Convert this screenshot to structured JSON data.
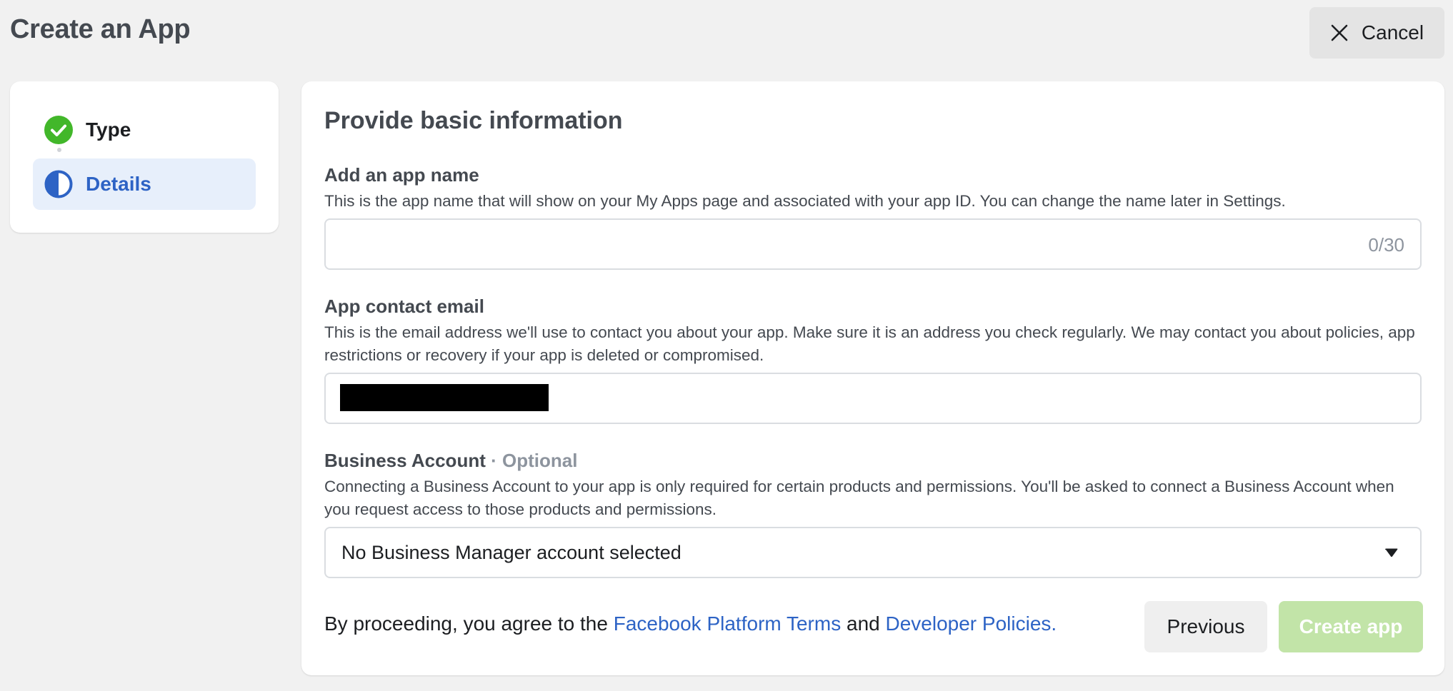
{
  "header": {
    "title": "Create an App",
    "cancel_label": "Cancel",
    "cancel_icon": "close-icon"
  },
  "stepper": {
    "steps": [
      {
        "label": "Type",
        "status": "completed",
        "icon": "check-circle-icon"
      },
      {
        "label": "Details",
        "status": "current",
        "icon": "half-circle-icon"
      }
    ]
  },
  "main": {
    "section_title": "Provide basic information",
    "app_name": {
      "label": "Add an app name",
      "description": "This is the app name that will show on your My Apps page and associated with your app ID. You can change the name later in Settings.",
      "value": "",
      "char_count": "0/30"
    },
    "contact_email": {
      "label": "App contact email",
      "description": "This is the email address we'll use to contact you about your app. Make sure it is an address you check regularly. We may contact you about policies, app restrictions or recovery if your app is deleted or compromised.",
      "value_redacted": true
    },
    "business_account": {
      "label": "Business Account",
      "optional_label": " · Optional",
      "description": "Connecting a Business Account to your app is only required for certain products and permissions. You'll be asked to connect a Business Account when you request access to those products and permissions.",
      "selected": "No Business Manager account selected",
      "caret_icon": "caret-down-icon"
    },
    "terms": {
      "prefix": "By proceeding, you agree to the ",
      "link1": "Facebook Platform Terms",
      "middle": " and ",
      "link2": "Developer Policies."
    },
    "buttons": {
      "previous": "Previous",
      "create": "Create app"
    }
  },
  "colors": {
    "background": "#f1f1f1",
    "link": "#2d63c5",
    "success": "#42b72a",
    "create_disabled": "#c2e4a8",
    "current_step_bg": "#e7effb"
  }
}
